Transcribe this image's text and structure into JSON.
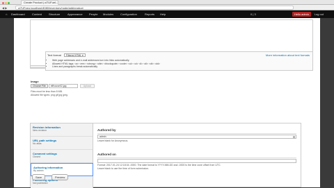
{
  "browser": {
    "tab_title": "Create Product | ci7UFuel...",
    "url": "ci7UFpeo.localhost:8080/inventory/node/add/product",
    "nav": "◀ ▶"
  },
  "toolbar": {
    "items": [
      "Dashboard",
      "Content",
      "Structure",
      "Appearance",
      "People",
      "Modules",
      "Configuration",
      "Reports",
      "Help"
    ],
    "shortcut": "0 | 3",
    "hello": "Hello admin",
    "logout": "Log out"
  },
  "text_format": {
    "label": "Text format",
    "selected": "Filtered HTML",
    "more_link": "More information about text formats",
    "tips": [
      "Web page addresses and e-mail addresses turn into links automatically.",
      "Allowed HTML tags: <a> <em> <strong> <cite> <blockquote> <code> <ul> <ol> <li> <dl> <dt> <dd>",
      "Lines and paragraphs break automatically."
    ]
  },
  "image": {
    "label": "Image",
    "choose_label": "Choose File",
    "file_name": "elfhouse02.jpg",
    "upload_label": "Upload",
    "help_size": "Files must be less than 8 MB.",
    "help_types": "Allowed file types: png gif jpg jpeg."
  },
  "vertical_tabs": [
    {
      "title": "Revision information",
      "summary": "New revision"
    },
    {
      "title": "URL path settings",
      "summary": "No alias"
    },
    {
      "title": "Comment settings",
      "summary": "Closed"
    },
    {
      "title": "Authoring information",
      "summary": "By admin"
    },
    {
      "title": "Publishing options",
      "summary": "Not published"
    }
  ],
  "authoring": {
    "authored_by_label": "Authored by",
    "authored_by_value": "admin",
    "authored_by_help": "Leave blank for Anonymous.",
    "authored_on_label": "Authored on",
    "authored_on_value": "",
    "authored_on_help1": "Format: 2017-01-24 12:18:34 -0000. The date format is YYYY-MM-DD and -0000 is the time zone offset from UTC.",
    "authored_on_help2": "Leave blank to use the time of form submission."
  },
  "actions": {
    "save": "Save",
    "preview": "Preview"
  }
}
